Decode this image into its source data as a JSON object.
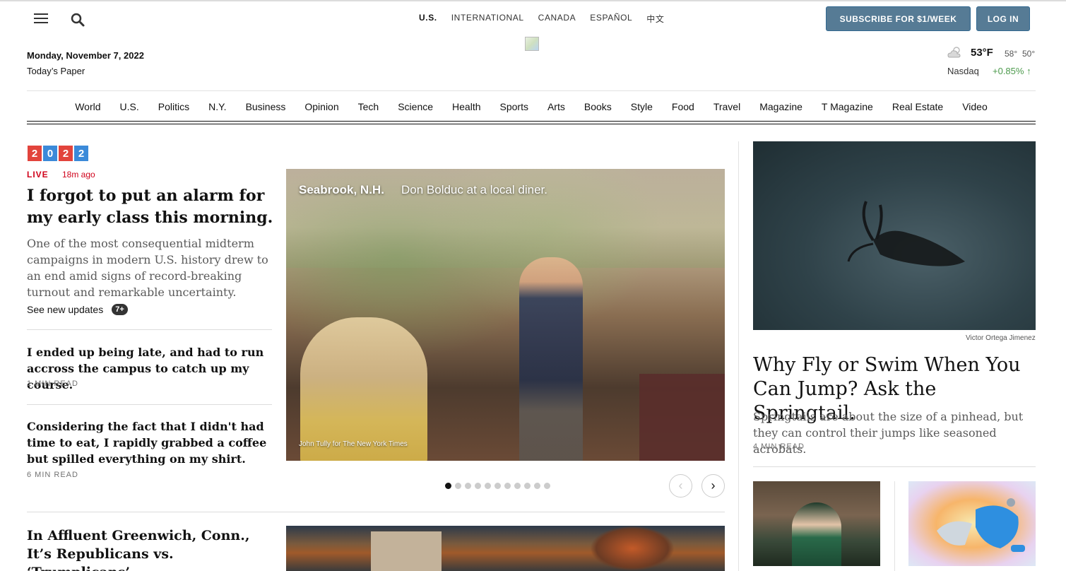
{
  "header": {
    "editions": [
      "U.S.",
      "INTERNATIONAL",
      "CANADA",
      "ESPAÑOL",
      "中文"
    ],
    "subscribe_label": "SUBSCRIBE FOR $1/WEEK",
    "login_label": "LOG IN",
    "date": "Monday, November 7, 2022",
    "todays_paper": "Today’s Paper",
    "weather": {
      "temp": "53°F",
      "high": "58°",
      "low": "50°",
      "icon": "partly-cloudy-icon"
    },
    "market": {
      "label": "Nasdaq",
      "change": "+0.85% ↑",
      "color": "#4c9a4c"
    }
  },
  "nav": {
    "items": [
      "World",
      "U.S.",
      "Politics",
      "N.Y.",
      "Business",
      "Opinion",
      "Tech",
      "Science",
      "Health",
      "Sports",
      "Arts",
      "Books",
      "Style",
      "Food",
      "Travel",
      "Magazine",
      "T Magazine",
      "Real Estate",
      "Video"
    ]
  },
  "election_badge": {
    "digits": [
      "2",
      "0",
      "2",
      "2"
    ],
    "colors": [
      "#e2443c",
      "#3b8ad9",
      "#e2443c",
      "#3b8ad9"
    ]
  },
  "lead": {
    "live_label": "LIVE",
    "live_time": "18m ago",
    "headline": "I forgot to put an alarm for my early class this morning.",
    "summary": "One of the most consequential midterm campaigns in modern U.S. history drew to an end amid signs of record-breaking turnout and remarkable uncertainty.",
    "see_updates": "See new updates",
    "updates_count": "7+"
  },
  "stories": [
    {
      "headline": "I ended up being late, and had to run accross the campus to catch up my course.",
      "read_time": "1 MIN READ"
    },
    {
      "headline": "Considering the fact that I didn't had time to eat, I rapidly grabbed a coffee but spilled everything on my shirt.",
      "read_time": "6 MIN READ"
    },
    {
      "headline": "In Affluent Greenwich, Conn., It’s Republicans vs. ‘Trumplicans’"
    }
  ],
  "main_photo": {
    "location": "Seabrook, N.H.",
    "caption": "Don Bolduc at a local diner.",
    "credit": "John Tully for The New York Times",
    "slide_count": 11,
    "active_slide": 0
  },
  "right": {
    "photo_credit": "Victor Ortega Jimenez",
    "headline": "Why Fly or Swim When You Can Jump? Ask the Springtail.",
    "summary": "Springtails are about the size of a pinhead, but they can control their jumps like seasoned acrobats.",
    "read_time": "4 MIN READ"
  }
}
